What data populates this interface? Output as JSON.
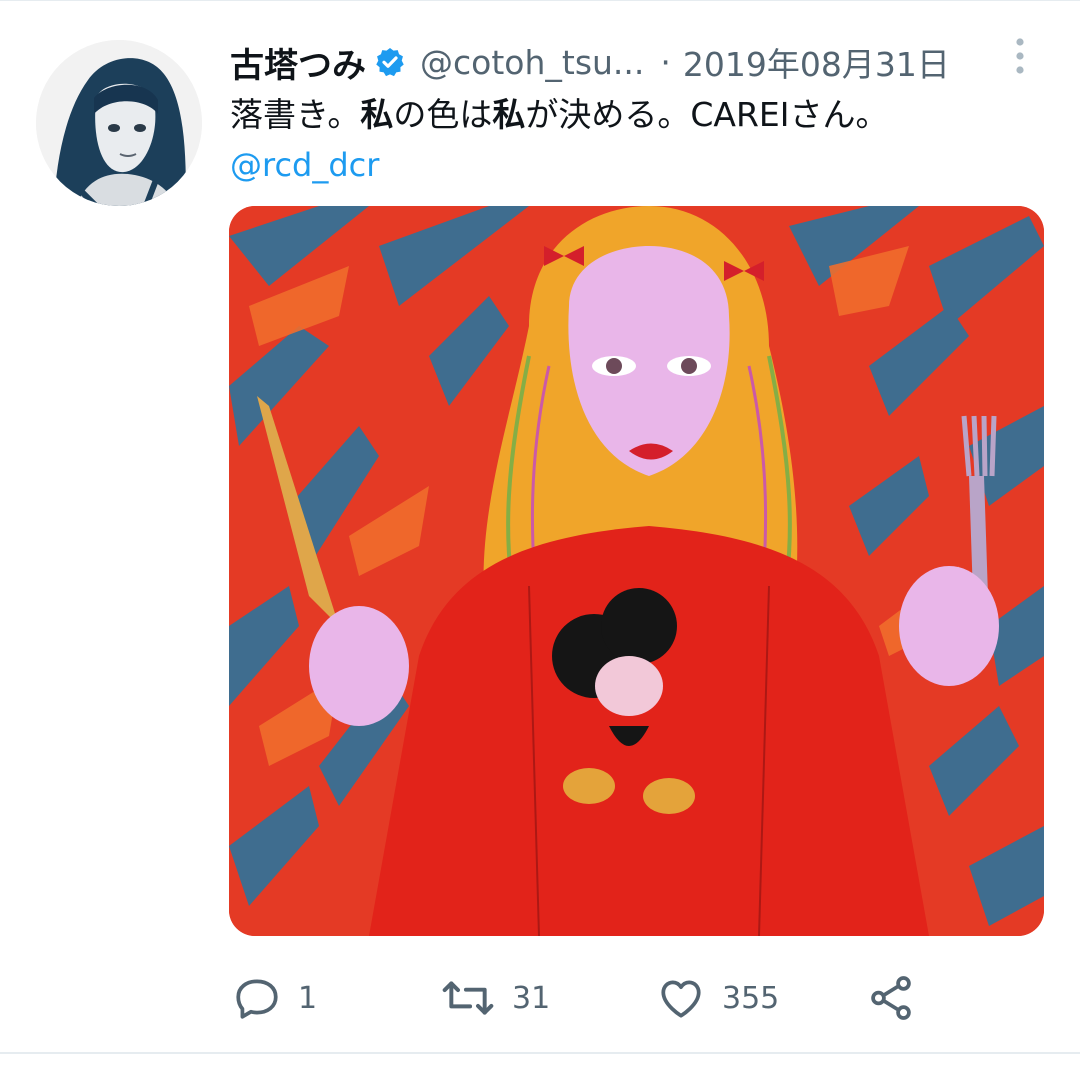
{
  "author": {
    "name": "古塔つみ",
    "handle": "@cotoh_tsu...",
    "separator": "·",
    "date": "2019年08月31日",
    "verified": true
  },
  "tweet": {
    "text_parts": [
      "落書き。",
      "私",
      "の色は",
      "私",
      "が決める。CAREIさん。"
    ],
    "mention": "@rcd_dcr"
  },
  "actions": {
    "reply_count": "1",
    "retweet_count": "31",
    "like_count": "355"
  },
  "colors": {
    "accent": "#1d9bf0",
    "muted": "#536471",
    "text": "#0f1419",
    "artwork_red": "#e43a25",
    "artwork_blue": "#3f6d8f"
  },
  "icons": [
    "verified-badge-icon",
    "more-options-icon",
    "reply-icon",
    "retweet-icon",
    "like-icon",
    "share-icon"
  ]
}
